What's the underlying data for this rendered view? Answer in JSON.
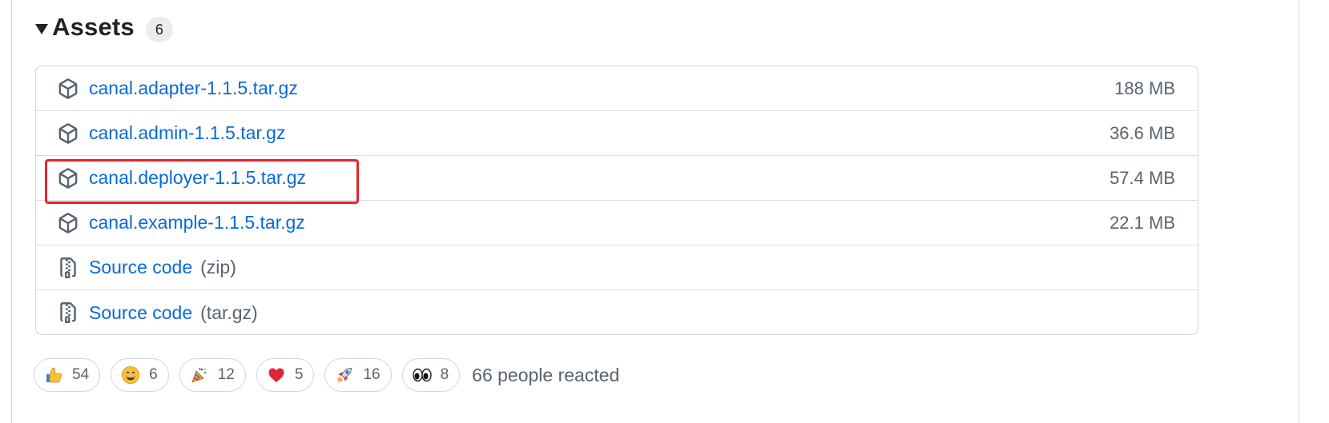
{
  "assets": {
    "title": "Assets",
    "count": "6",
    "items": [
      {
        "name": "canal.adapter-1.1.5.tar.gz",
        "suffix": "",
        "size": "188 MB",
        "icon": "package-icon"
      },
      {
        "name": "canal.admin-1.1.5.tar.gz",
        "suffix": "",
        "size": "36.6 MB",
        "icon": "package-icon"
      },
      {
        "name": "canal.deployer-1.1.5.tar.gz",
        "suffix": "",
        "size": "57.4 MB",
        "icon": "package-icon",
        "highlighted": true
      },
      {
        "name": "canal.example-1.1.5.tar.gz",
        "suffix": "",
        "size": "22.1 MB",
        "icon": "package-icon"
      },
      {
        "name": "Source code",
        "suffix": "(zip)",
        "size": "",
        "icon": "file-zip-icon"
      },
      {
        "name": "Source code",
        "suffix": "(tar.gz)",
        "size": "",
        "icon": "file-zip-icon"
      }
    ]
  },
  "reactions": {
    "items": [
      {
        "emoji": "thumbs-up",
        "count": "54"
      },
      {
        "emoji": "laugh",
        "count": "6"
      },
      {
        "emoji": "hooray",
        "count": "12"
      },
      {
        "emoji": "heart",
        "count": "5"
      },
      {
        "emoji": "rocket",
        "count": "16"
      },
      {
        "emoji": "eyes",
        "count": "8"
      }
    ],
    "summary": "66 people reacted"
  },
  "colors": {
    "link": "#0969da",
    "muted": "#59636e",
    "border": "#d0d7de",
    "highlight": "#e5252a"
  }
}
